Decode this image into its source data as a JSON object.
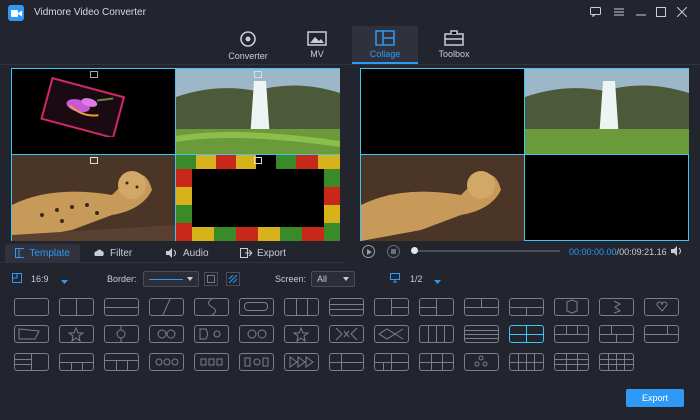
{
  "app": {
    "title": "Vidmore Video Converter"
  },
  "nav": {
    "tabs": [
      {
        "label": "Converter",
        "icon": "converter-icon"
      },
      {
        "label": "MV",
        "icon": "mv-icon"
      },
      {
        "label": "Collage",
        "icon": "collage-icon",
        "active": true
      },
      {
        "label": "Toolbox",
        "icon": "toolbox-icon"
      }
    ]
  },
  "editor_tabs": [
    {
      "label": "Template",
      "icon": "template-icon",
      "active": true
    },
    {
      "label": "Filter",
      "icon": "filter-icon"
    },
    {
      "label": "Audio",
      "icon": "audio-icon"
    },
    {
      "label": "Export",
      "icon": "export-icon"
    }
  ],
  "player": {
    "current_time": "00:00:00.00",
    "total_time": "00:09:21.16",
    "progress": 0.0
  },
  "toolbar": {
    "aspect_ratio": "16:9",
    "border_label": "Border:",
    "screen_label": "Screen:",
    "screen_value": "All",
    "page": "1/2"
  },
  "export_label": "Export",
  "colors": {
    "accent": "#2e9af5",
    "highlight": "#3cc6f5",
    "background": "#23252e"
  }
}
